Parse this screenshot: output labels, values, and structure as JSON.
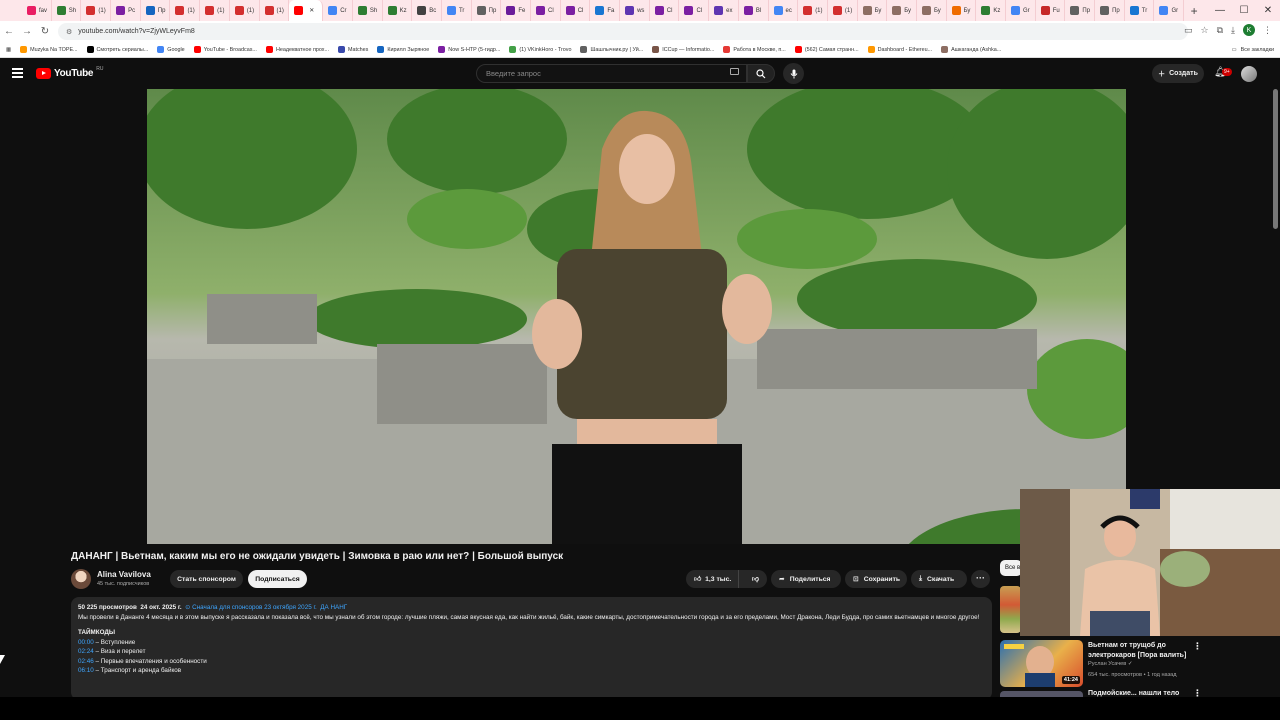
{
  "browser": {
    "tabs": [
      "fav",
      "Sh",
      "(1)",
      "Рс",
      "Пр",
      "(1)",
      "(1)",
      "(1)",
      "(1)",
      "",
      "Cr",
      "Sh",
      "Kz",
      "Bc",
      "Tr",
      "Пр",
      "Fe",
      "Cl",
      "Cl",
      "Fa",
      "ws",
      "Cl",
      "Cl",
      "ex",
      "Bl",
      "ec",
      "(1)",
      "(1)",
      "Бу",
      "Бу",
      "Бу",
      "Бу",
      "Kz",
      "Gr",
      "Fu",
      "Пр",
      "Пр",
      "Tr",
      "Gr"
    ],
    "url": "youtube.com/watch?v=ZjyWLeyvFm8",
    "profile_initial": "K",
    "bookmarks": [
      "Muzyka Na TOPE...",
      "Смотреть сериалы...",
      "Google",
      "YouTube - Broadcas...",
      "Неадекватное прох...",
      "Matches",
      "Кирилл Зыряное",
      "Now S-HTP (5-гидр...",
      "(1) VKinkHoro - Trovo",
      "Шашлычник.ру | Уй...",
      "ICCup — Informatio...",
      "Работа в Москве, п...",
      "(562) Самая странн...",
      "Dashboard - Ethereu...",
      "Ашкаганда (Ashka..."
    ],
    "bookmarks_all": "Все закладки",
    "tab_colors": [
      "#e91e63",
      "#2e7d32",
      "#d32f2f",
      "#7b1fa2",
      "#1565c0",
      "#d32f2f",
      "#d32f2f",
      "#d32f2f",
      "#d32f2f",
      "#ff0000",
      "#4285f4",
      "#2e7d32",
      "#2e7d32",
      "#424242",
      "#4285f4",
      "#616161",
      "#6a1b9a",
      "#7b1fa2",
      "#7b1fa2",
      "#1976d2",
      "#5e35b1",
      "#7b1fa2",
      "#7b1fa2",
      "#5e35b1",
      "#7b1fa2",
      "#4285f4",
      "#d32f2f",
      "#d32f2f",
      "#8d6e63",
      "#8d6e63",
      "#8d6e63",
      "#ef6c00",
      "#2e7d32",
      "#4285f4",
      "#c62828",
      "#616161",
      "#616161",
      "#1976d2",
      "#4285f4"
    ]
  },
  "header": {
    "logo": "YouTube",
    "region": "RU",
    "search_placeholder": "Введите запрос",
    "create_label": "Создать",
    "notif_count": "9+"
  },
  "video": {
    "title": "ДАНАНГ | Вьетнам, каким мы его не ожидали увидеть | Зимовка в раю или нет? | Большой выпуск",
    "channel": "Alina Vavilova",
    "subscribers": "45 тыс. подписчиков",
    "sponsor_label": "Стать спонсором",
    "subscribe_label": "Подписаться",
    "likes": "1,3 тыс.",
    "share_label": "Поделиться",
    "save_label": "Сохранить",
    "download_label": "Скачать"
  },
  "description": {
    "views": "50 225 просмотров",
    "date": "24 окт. 2025 г.",
    "early": "⊙ Сначала для спонсоров 23 октября 2025 г.",
    "hashtag": "ДА НАНГ",
    "text": "Мы провели в Дананге 4 месяца и в этом выпуске я рассказала и показала всё, что мы узнали об этом городе: лучшие пляжи, самая вкусная еда, как найти жильё, байк, какие симкарты, достопримечательности города и за его пределами, Мост Дракона, Леди Будда, про самих вьетнамцев и многое другое!",
    "timecodes_header": "ТАЙМКОДЫ",
    "timecodes": [
      {
        "t": "00:00",
        "label": "– Вступление"
      },
      {
        "t": "02:24",
        "label": "– Виза и перелет"
      },
      {
        "t": "02:46",
        "label": "– Первые впечатления и особенности"
      },
      {
        "t": "06:10",
        "label": "– Транспорт и аренда байков"
      }
    ]
  },
  "sidebar": {
    "chip": "Все в",
    "rec": {
      "title": "Вьетнам от трущоб до электрокаров [Пора валить]",
      "channel": "Руслан Усачев",
      "meta": "654 тыс. просмотров • 1 год назад",
      "duration": "41:24"
    },
    "rec2_title": "Подмойские... нашли тело"
  }
}
